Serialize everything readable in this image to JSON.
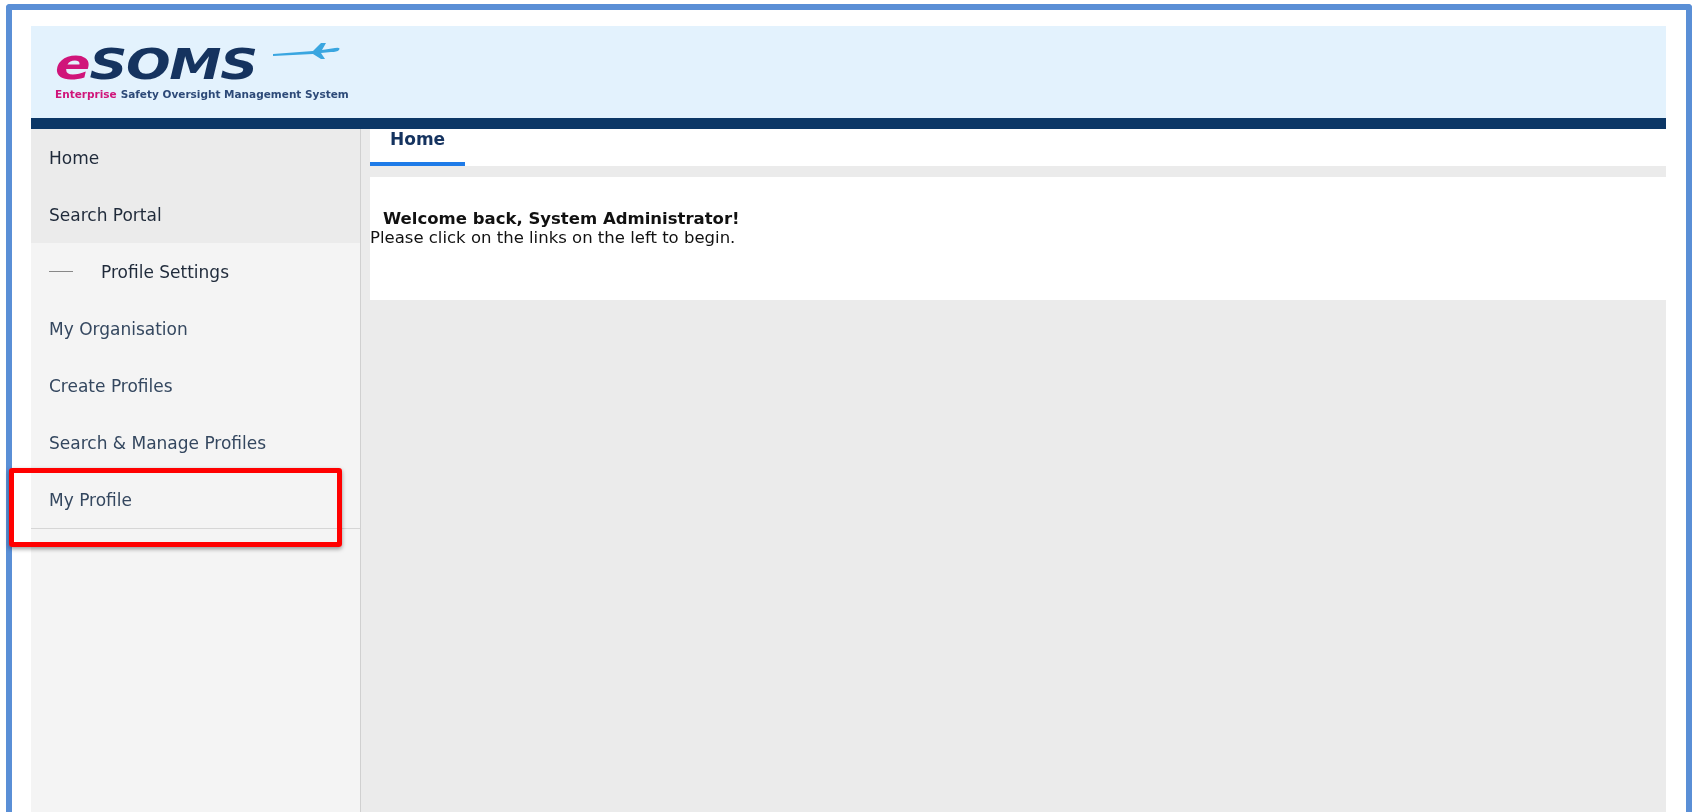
{
  "logo": {
    "mark_lead": "e",
    "mark": "SOMS",
    "tagline_lead": "Enterprise",
    "tagline": "Safety Oversight Management System"
  },
  "sidebar": {
    "items": [
      {
        "label": "Home",
        "kind": "link",
        "highlighted": false
      },
      {
        "label": "Search Portal",
        "kind": "link",
        "highlighted": false
      },
      {
        "label": "Profile Settings",
        "kind": "group",
        "expanded": true,
        "children": [
          {
            "label": "My Organisation",
            "kind": "link",
            "highlighted": false
          },
          {
            "label": "Create Profiles",
            "kind": "link",
            "highlighted": false
          },
          {
            "label": "Search & Manage Profiles",
            "kind": "link",
            "highlighted": false
          },
          {
            "label": "My Profile",
            "kind": "link",
            "highlighted": true
          }
        ]
      }
    ]
  },
  "tabs": [
    {
      "label": "Home",
      "selected": true
    }
  ],
  "panel": {
    "heading": "Welcome back, System Administrator!",
    "text": "Please click on the links on the left to begin."
  }
}
